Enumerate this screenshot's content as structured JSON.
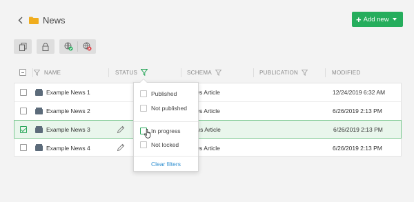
{
  "header": {
    "title": "News",
    "back_icon": "chevron-left-icon",
    "folder_icon": "folder-icon",
    "folder_color": "#f0ad1e"
  },
  "actions": {
    "add_new_label": "Add new",
    "accent": "#25ad5c"
  },
  "toolbar": {
    "buttons": [
      "copy-icon",
      "lock-icon",
      "publish-icon",
      "unpublish-icon"
    ]
  },
  "table": {
    "columns": [
      "NAME",
      "STATUS",
      "SCHEMA",
      "PUBLICATION",
      "MODIFIED"
    ],
    "rows": [
      {
        "name": "Example News 1",
        "schema": "ws Article",
        "modified": "12/24/2019 6:32 AM",
        "selected": false
      },
      {
        "name": "Example News 2",
        "schema": "ws Article",
        "modified": "6/26/2019 2:13 PM",
        "selected": false
      },
      {
        "name": "Example News 3",
        "schema": "ws Article",
        "modified": "6/26/2019 2:13 PM",
        "selected": true
      },
      {
        "name": "Example News 4",
        "schema": "ws Article",
        "modified": "6/26/2019 2:13 PM",
        "selected": false
      }
    ]
  },
  "status_filter": {
    "options": [
      "Published",
      "Not published",
      "In progress",
      "Not locked"
    ],
    "clear_label": "Clear filters",
    "link_color": "#2f8fd0"
  }
}
